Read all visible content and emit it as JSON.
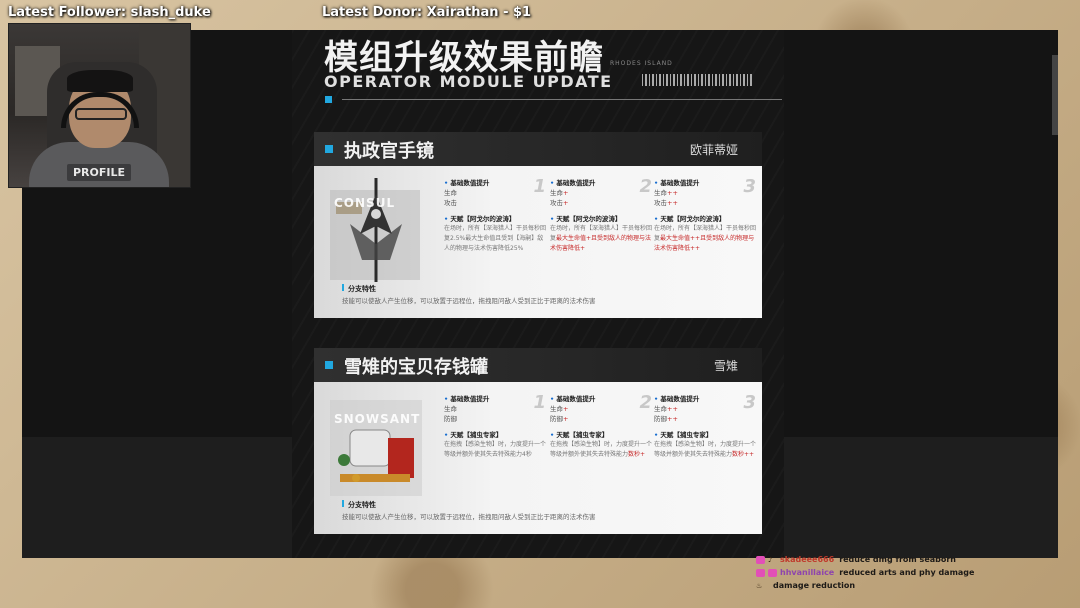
{
  "overlay": {
    "latest_follower": "Latest Follower: slash_duke",
    "latest_donor": "Latest Donor: Xairathan - $1"
  },
  "webcam": {
    "shirt_text": "PROFILE"
  },
  "slide": {
    "title": "模组升级效果前瞻",
    "subtitle": "OPERATOR MODULE UPDATE",
    "org": "RHODES ISLAND",
    "cards": [
      {
        "title": "执政官手镜",
        "operator": "欧菲蒂娅",
        "art_label": "CONSUL",
        "stages": [
          {
            "num": "1",
            "header": "基础数值提升",
            "stat1": "生命",
            "stat2": "攻击",
            "plus1": "",
            "plus2": "",
            "talent": "天赋【阿戈尔的波涛】",
            "desc": "在场时，所有【深海猎人】干员每秒回复2.5%最大生命值且受到【海嗣】敌人的物理与法术伤害降低25%",
            "hl": ""
          },
          {
            "num": "2",
            "header": "基础数值提升",
            "stat1": "生命",
            "stat2": "攻击",
            "plus1": "+",
            "plus2": "+",
            "talent": "天赋【阿戈尔的波涛】",
            "desc": "在场时，所有【深海猎人】干员每秒回复",
            "hl": "最大生命值+且受到敌人的物理与法术伤害降低+"
          },
          {
            "num": "3",
            "header": "基础数值提升",
            "stat1": "生命",
            "stat2": "攻击",
            "plus1": "++",
            "plus2": "++",
            "talent": "天赋【阿戈尔的波涛】",
            "desc": "在场时，所有【深海猎人】干员每秒回复",
            "hl": "最大生命值++且受到敌人的物理与法术伤害降低++"
          }
        ],
        "branch_title": "分支特性",
        "branch_desc": "技能可以使敌人产生位移，可以放置于远程位，拖拽阻问敌人受到正比于距离的法术伤害"
      },
      {
        "title": "雪雉的宝贝存钱罐",
        "operator": "雪雉",
        "art_label": "SNOWSANT",
        "stages": [
          {
            "num": "1",
            "header": "基础数值提升",
            "stat1": "生命",
            "stat2": "防御",
            "plus1": "",
            "plus2": "",
            "talent": "天赋【捕虫专家】",
            "desc": "在拖拽【感染生物】时，力度提升一个等级并额外使其失去特殊能力4秒",
            "hl": ""
          },
          {
            "num": "2",
            "header": "基础数值提升",
            "stat1": "生命",
            "stat2": "防御",
            "plus1": "+",
            "plus2": "+",
            "talent": "天赋【捕虫专家】",
            "desc": "在拖拽【感染生物】时，力度提升一个等级并额外使其失去特殊能力",
            "hl": "数秒+"
          },
          {
            "num": "3",
            "header": "基础数值提升",
            "stat1": "生命",
            "stat2": "防御",
            "plus1": "++",
            "plus2": "++",
            "talent": "天赋【捕虫专家】",
            "desc": "在拖拽【感染生物】时，力度提升一个等级并额外使其失去特殊能力",
            "hl": "数秒++"
          }
        ],
        "branch_title": "分支特性",
        "branch_desc": "技能可以使敌人产生位移，可以放置于远程位，拖拽阻问敌人受到正比于距离的法术伤害"
      }
    ]
  },
  "chat": [
    {
      "user": "skadeee666",
      "user_color": "#c0392b",
      "message": "reduce dmg from seaborn"
    },
    {
      "user": "hhvanillaice",
      "user_color": "#8e44ad",
      "message": "reduced arts and phy damage"
    },
    {
      "user": "",
      "user_color": "#2e9e3a",
      "message": "damage reduction"
    }
  ]
}
